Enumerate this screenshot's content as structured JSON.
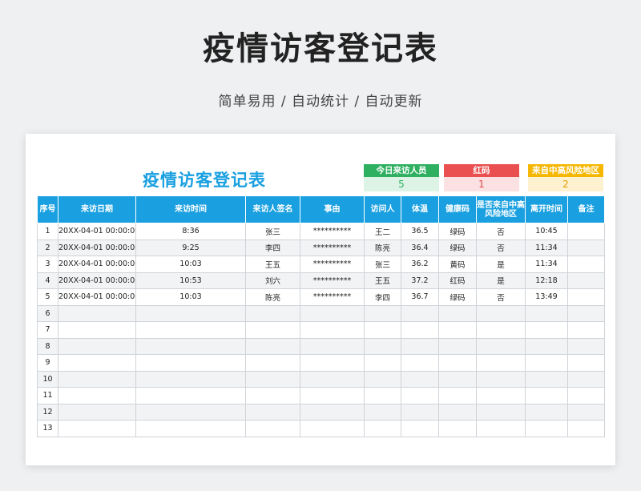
{
  "page": {
    "title": "疫情访客登记表",
    "subtitle": "简单易用 / 自动统计 / 自动更新"
  },
  "sheet": {
    "title": "疫情访客登记表",
    "stats": {
      "visitors": {
        "label": "今日来访人员",
        "value": "5",
        "color": "#2fb061"
      },
      "red_code": {
        "label": "红码",
        "value": "1",
        "color": "#ea5050"
      },
      "risk": {
        "label": "来自中高风险地区",
        "value": "2",
        "color": "#f5b700"
      }
    },
    "accent_color": "#1aa0e0"
  },
  "table": {
    "headers": [
      "序号",
      "来访日期",
      "来访时间",
      "来访人签名",
      "事由",
      "访问人",
      "体温",
      "健康码",
      "是否来自中高风险地区",
      "离开时间",
      "备注"
    ],
    "rows": [
      {
        "no": "1",
        "date": "20XX-04-01 00:00:00",
        "time": "8:36",
        "visitor": "张三",
        "reason": "**********",
        "host": "王二",
        "temp": "36.5",
        "code": "绿码",
        "risk": "否",
        "leave": "10:45",
        "note": ""
      },
      {
        "no": "2",
        "date": "20XX-04-01 00:00:00",
        "time": "9:25",
        "visitor": "李四",
        "reason": "**********",
        "host": "陈亮",
        "temp": "36.4",
        "code": "绿码",
        "risk": "否",
        "leave": "11:34",
        "note": ""
      },
      {
        "no": "3",
        "date": "20XX-04-01 00:00:00",
        "time": "10:03",
        "visitor": "王五",
        "reason": "**********",
        "host": "张三",
        "temp": "36.2",
        "code": "黄码",
        "risk": "是",
        "leave": "11:34",
        "note": ""
      },
      {
        "no": "4",
        "date": "20XX-04-01 00:00:00",
        "time": "10:53",
        "visitor": "刘六",
        "reason": "**********",
        "host": "王五",
        "temp": "37.2",
        "code": "红码",
        "risk": "是",
        "leave": "12:18",
        "note": ""
      },
      {
        "no": "5",
        "date": "20XX-04-01 00:00:00",
        "time": "10:03",
        "visitor": "陈亮",
        "reason": "**********",
        "host": "李四",
        "temp": "36.7",
        "code": "绿码",
        "risk": "否",
        "leave": "13:49",
        "note": ""
      },
      {
        "no": "6",
        "date": "",
        "time": "",
        "visitor": "",
        "reason": "",
        "host": "",
        "temp": "",
        "code": "",
        "risk": "",
        "leave": "",
        "note": ""
      },
      {
        "no": "7",
        "date": "",
        "time": "",
        "visitor": "",
        "reason": "",
        "host": "",
        "temp": "",
        "code": "",
        "risk": "",
        "leave": "",
        "note": ""
      },
      {
        "no": "8",
        "date": "",
        "time": "",
        "visitor": "",
        "reason": "",
        "host": "",
        "temp": "",
        "code": "",
        "risk": "",
        "leave": "",
        "note": ""
      },
      {
        "no": "9",
        "date": "",
        "time": "",
        "visitor": "",
        "reason": "",
        "host": "",
        "temp": "",
        "code": "",
        "risk": "",
        "leave": "",
        "note": ""
      },
      {
        "no": "10",
        "date": "",
        "time": "",
        "visitor": "",
        "reason": "",
        "host": "",
        "temp": "",
        "code": "",
        "risk": "",
        "leave": "",
        "note": ""
      },
      {
        "no": "11",
        "date": "",
        "time": "",
        "visitor": "",
        "reason": "",
        "host": "",
        "temp": "",
        "code": "",
        "risk": "",
        "leave": "",
        "note": ""
      },
      {
        "no": "12",
        "date": "",
        "time": "",
        "visitor": "",
        "reason": "",
        "host": "",
        "temp": "",
        "code": "",
        "risk": "",
        "leave": "",
        "note": ""
      },
      {
        "no": "13",
        "date": "",
        "time": "",
        "visitor": "",
        "reason": "",
        "host": "",
        "temp": "",
        "code": "",
        "risk": "",
        "leave": "",
        "note": ""
      }
    ],
    "status_colors": {
      "绿码": "#2fb061",
      "黄码": "#e6a800",
      "红码": "#e04848",
      "fever": "#e04848"
    }
  }
}
